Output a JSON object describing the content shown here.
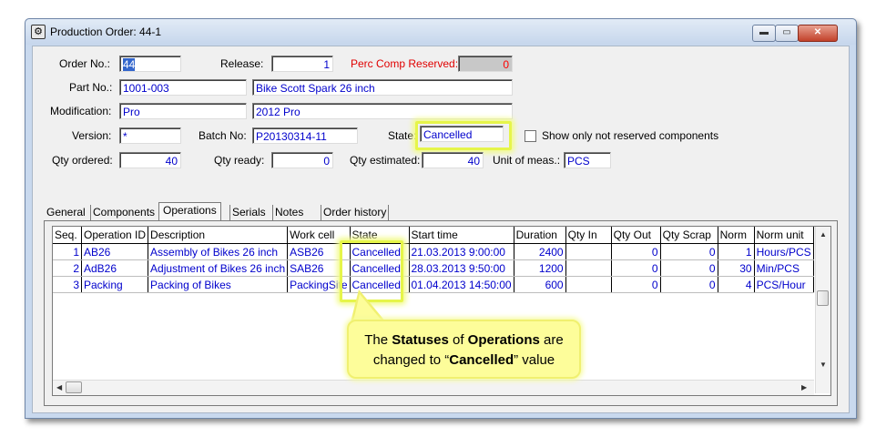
{
  "window": {
    "title": "Production Order: 44-1",
    "buttons": {
      "minimize": "▬",
      "maximize": "▭",
      "close": "✕"
    }
  },
  "form": {
    "order_no": {
      "label": "Order No.:",
      "value": "44"
    },
    "release": {
      "label": "Release:",
      "value": "1"
    },
    "perc_comp_reserved": {
      "label": "Perc Comp Reserved:",
      "value": "0"
    },
    "part_no": {
      "label": "Part No.:",
      "value": "1001-003",
      "description": "Bike Scott Spark 26 inch"
    },
    "modification": {
      "label": "Modification:",
      "value": "Pro",
      "description": "2012 Pro"
    },
    "version": {
      "label": "Version:",
      "value": "*"
    },
    "batch_no": {
      "label": "Batch No:",
      "value": "P20130314-11"
    },
    "state": {
      "label": "State:",
      "value": "Cancelled"
    },
    "show_only_not_reserved": {
      "label": "Show only not reserved components",
      "checked": false
    },
    "qty_ordered": {
      "label": "Qty ordered:",
      "value": "40"
    },
    "qty_ready": {
      "label": "Qty ready:",
      "value": "0"
    },
    "qty_estimated": {
      "label": "Qty estimated:",
      "value": "40"
    },
    "unit_of_meas": {
      "label": "Unit of meas.:",
      "value": "PCS"
    }
  },
  "tabs": [
    {
      "label": "General"
    },
    {
      "label": "Components"
    },
    {
      "label": "Operations",
      "active": true
    },
    {
      "label": "Serials"
    },
    {
      "label": "Notes"
    },
    {
      "label": "Order history"
    }
  ],
  "operations": {
    "columns": [
      "Seq.",
      "Operation ID",
      "Description",
      "Work cell",
      "State",
      "Start time",
      "Duration",
      "Qty In",
      "Qty Out",
      "Qty Scrap",
      "Norm",
      "Norm unit"
    ],
    "rows": [
      [
        "1",
        "AB26",
        "Assembly of Bikes 26 inch",
        "ASB26",
        "Cancelled",
        "21.03.2013 9:00:00",
        "2400",
        "",
        "0",
        "0",
        "1",
        "Hours/PCS"
      ],
      [
        "2",
        "AdB26",
        "Adjustment of Bikes 26 inch",
        "SAB26",
        "Cancelled",
        "28.03.2013 9:50:00",
        "1200",
        "",
        "0",
        "0",
        "30",
        "Min/PCS"
      ],
      [
        "3",
        "Packing",
        "Packing of Bikes",
        "PackingSite",
        "Cancelled",
        "01.04.2013 14:50:00",
        "600",
        "",
        "0",
        "0",
        "4",
        "PCS/Hour"
      ]
    ]
  },
  "callout": {
    "parts": [
      "The ",
      "Statuses",
      " of ",
      "Operations",
      " are changed to “",
      "Cancelled",
      "” value"
    ]
  },
  "colors": {
    "value_text": "#0000cc",
    "highlight": "#e6f54a",
    "callout_bg": "#fdfd9a",
    "red_label": "#e00000"
  }
}
